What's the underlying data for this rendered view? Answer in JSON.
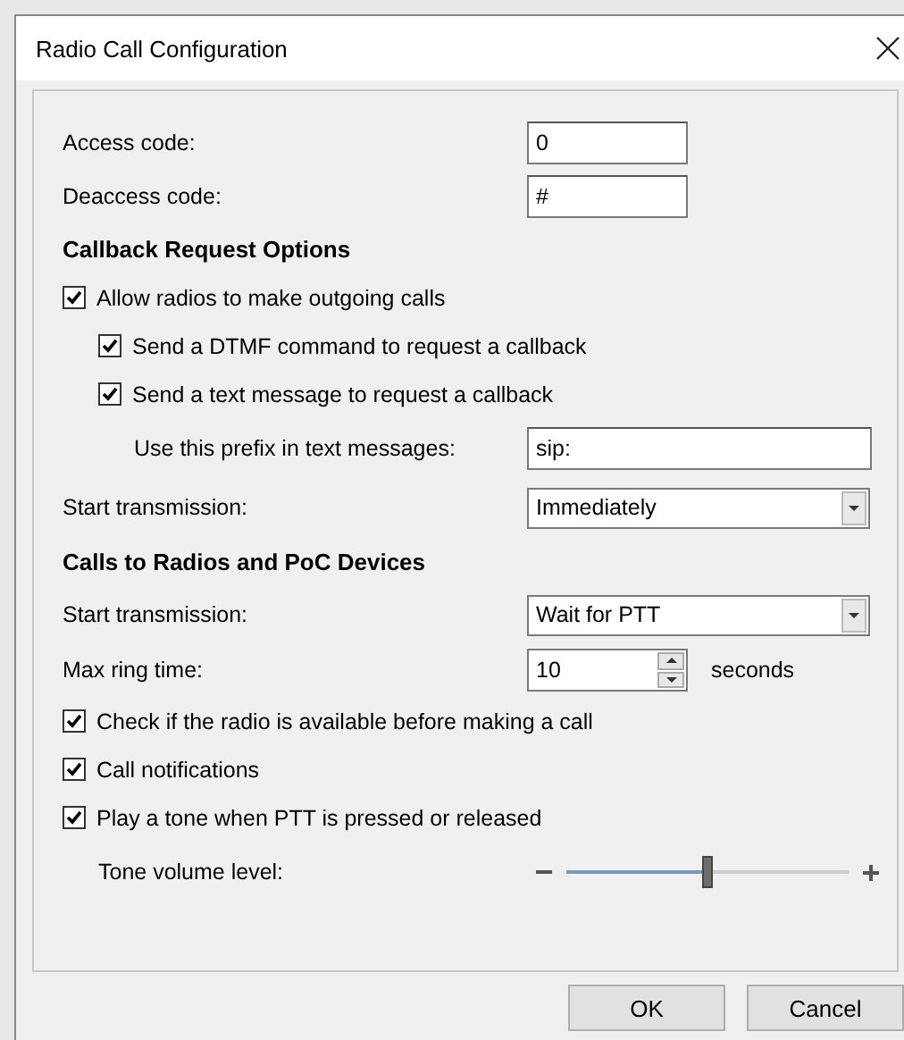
{
  "window": {
    "title": "Radio Call Configuration"
  },
  "rows": [
    {
      "kind": "field",
      "label": "Access code:",
      "value": "0",
      "wide": false
    },
    {
      "kind": "field",
      "label": "Deaccess code:",
      "value": "#",
      "wide": false
    },
    {
      "kind": "heading",
      "label": "Callback Request Options"
    },
    {
      "kind": "checkbox",
      "label": "Allow radios to make outgoing calls",
      "checked": true,
      "children": [
        {
          "kind": "checkbox",
          "label": "Send a DTMF command to request a callback",
          "checked": true
        },
        {
          "kind": "checkbox",
          "label": "Send a text message to request a callback",
          "checked": true,
          "children": [
            {
              "kind": "field",
              "label": "Use this prefix in text messages:",
              "value": "sip:",
              "wide": true
            }
          ]
        }
      ]
    },
    {
      "kind": "dropdown",
      "label": "Start transmission:",
      "value": "Immediately"
    },
    {
      "kind": "heading",
      "label": "Calls to Radios and PoC Devices"
    },
    {
      "kind": "dropdown",
      "label": "Start transmission:",
      "value": "Wait for PTT"
    },
    {
      "kind": "spinner",
      "label": "Max ring time:",
      "value": "10",
      "unit": "seconds"
    },
    {
      "kind": "checkbox",
      "label": "Check if the radio is available before making a call",
      "checked": true
    },
    {
      "kind": "checkbox",
      "label": "Call notifications",
      "checked": true
    },
    {
      "kind": "checkbox",
      "label": "Play a tone when PTT is pressed or released",
      "checked": true,
      "children": [
        {
          "kind": "slider",
          "label": "Tone volume level:",
          "level": 0.5
        }
      ]
    }
  ],
  "buttons": [
    {
      "label": "OK"
    },
    {
      "label": "Cancel"
    }
  ]
}
